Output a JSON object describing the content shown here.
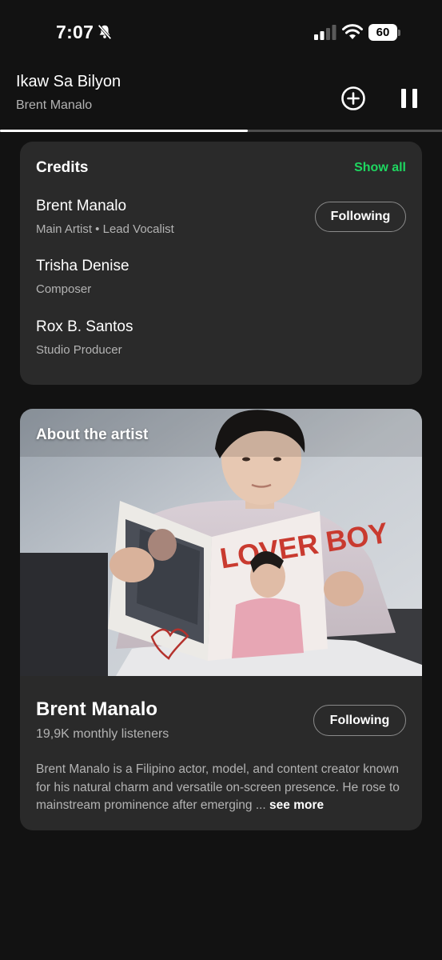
{
  "status_bar": {
    "time": "7:07",
    "battery": "60",
    "icons": [
      "bell-off-icon",
      "signal-icon",
      "wifi-icon",
      "battery-icon"
    ]
  },
  "now_playing": {
    "title": "Ikaw Sa Bilyon",
    "artist": "Brent Manalo",
    "progress": 0.56,
    "icons": [
      "add-circle-icon",
      "pause-icon"
    ]
  },
  "credits": {
    "heading": "Credits",
    "show_all": "Show all",
    "people": [
      {
        "name": "Brent Manalo",
        "role": "Main Artist • Lead Vocalist",
        "follow": "Following"
      },
      {
        "name": "Trisha Denise",
        "role": "Composer"
      },
      {
        "name": "Rox B. Santos",
        "role": "Studio Producer"
      }
    ]
  },
  "about": {
    "heading": "About the artist",
    "artist_name": "Brent Manalo",
    "listeners": "19,9K monthly listeners",
    "follow": "Following",
    "bio": "Brent Manalo is a Filipino actor, model, and content creator known for his natural charm and versatile on-screen presence. He rose to mainstream prominence after emerging ...",
    "see_more": "see more",
    "photo_magazine_title": "LOVER BOY",
    "photo_signature": "Brent"
  },
  "colors": {
    "background": "#121212",
    "card": "#2a2a2a",
    "accent": "#1ed760",
    "secondary_text": "#b3b3b3"
  }
}
